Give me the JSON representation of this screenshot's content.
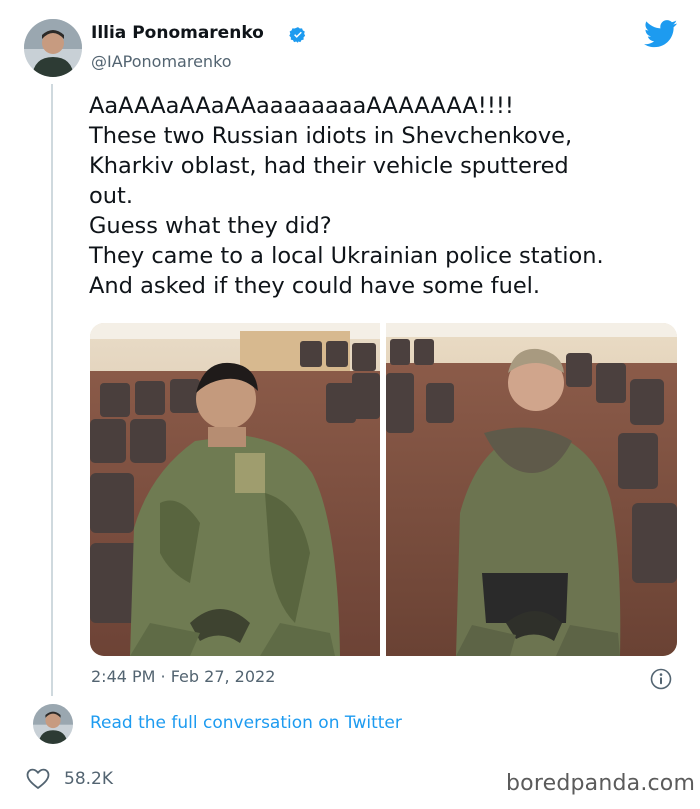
{
  "tweet": {
    "author_name": "Illia Ponomarenko",
    "author_handle": "@IAPonomarenko",
    "verified": true,
    "text_lines": [
      "AaAAAaAAaAAaaaaaaaaAAAAAAA!!!!",
      "These two Russian idiots in Shevchenkove,",
      "Kharkiv oblast, had their vehicle sputtered",
      "out.",
      "Guess what they did?",
      "They came to a local Ukrainian police station.",
      "And asked if they could have some fuel."
    ],
    "timestamp": "2:44 PM · Feb 27, 2022",
    "read_link": "Read the full conversation on Twitter",
    "likes": "58.2K"
  },
  "watermark": "boredpanda.com",
  "colors": {
    "twitter_blue": "#1d9bf0",
    "text_primary": "#0f1419",
    "text_secondary": "#536471",
    "thread_line": "#cfd9de"
  },
  "icons": {
    "verified": "verified-badge-icon",
    "brand": "twitter-bird-icon",
    "info": "info-icon",
    "like": "heart-icon"
  }
}
